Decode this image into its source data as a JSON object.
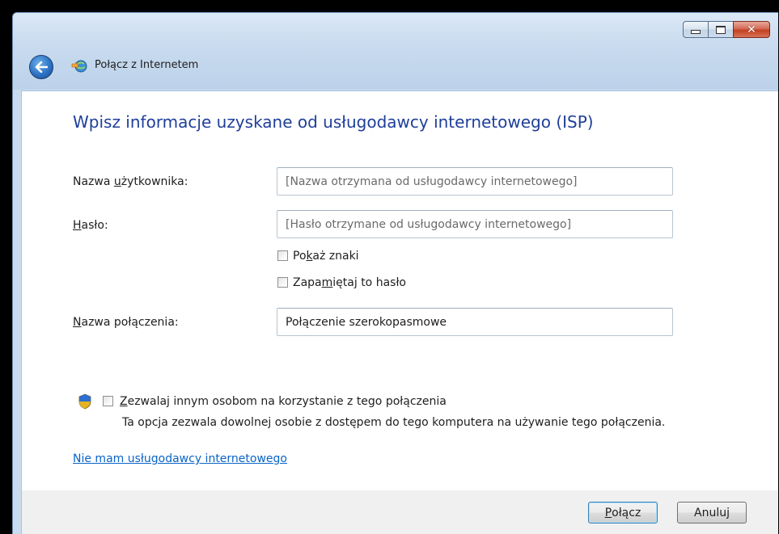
{
  "window": {
    "title": "Połącz z Internetem",
    "controls": {
      "minimize": "minimize",
      "maximize": "maximize",
      "close": "✕"
    }
  },
  "form": {
    "heading": "Wpisz informacje uzyskane od usługodawcy internetowego (ISP)",
    "username": {
      "label_pre": "Nazwa ",
      "label_key": "u",
      "label_post": "żytkownika:",
      "placeholder": "[Nazwa otrzymana od usługodawcy internetowego]",
      "value": ""
    },
    "password": {
      "label_key": "H",
      "label_post": "asło:",
      "placeholder": "[Hasło otrzymane od usługodawcy internetowego]",
      "value": ""
    },
    "show_chars": {
      "pre": "Po",
      "key": "k",
      "post": "aż znaki",
      "checked": false
    },
    "remember": {
      "pre": "Zapa",
      "key": "m",
      "post": "iętaj to hasło",
      "checked": false
    },
    "connection_name": {
      "label_key": "N",
      "label_post": "azwa połączenia:",
      "value": "Połączenie szerokopasmowe"
    },
    "allow_others": {
      "key": "Z",
      "post": "ezwalaj innym osobom na korzystanie z tego połączenia",
      "checked": false,
      "description": "Ta opcja zezwala dowolnej osobie z dostępem do tego komputera na używanie tego połączenia."
    },
    "no_isp_link": "Nie mam usługodawcy internetowego"
  },
  "buttons": {
    "connect": {
      "key": "P",
      "post": "ołącz"
    },
    "cancel": "Anuluj"
  },
  "colors": {
    "heading": "#1f3f9a",
    "link": "#0a64c8",
    "chrome": "#c9dcef"
  }
}
